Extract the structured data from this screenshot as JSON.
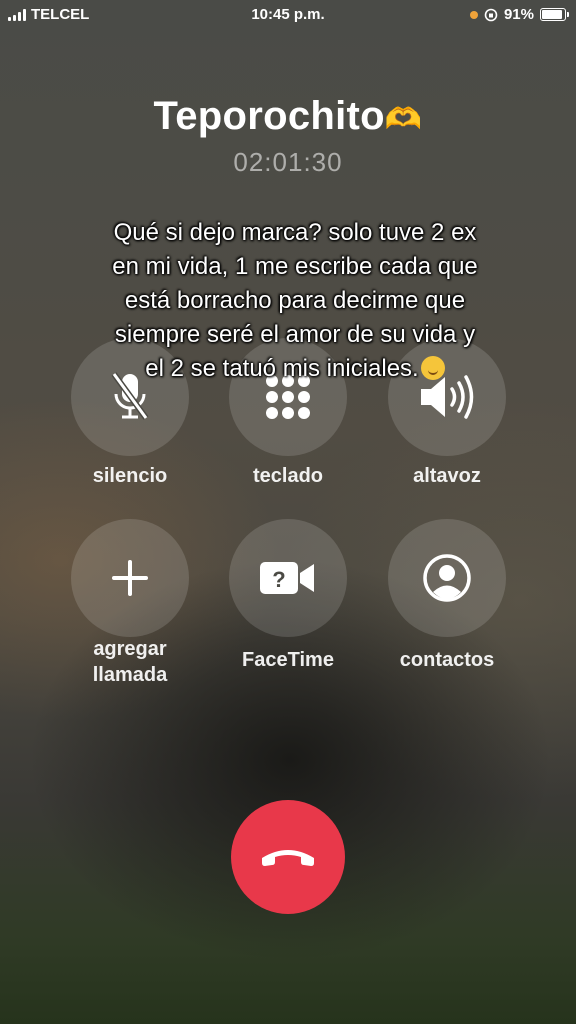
{
  "status_bar": {
    "carrier": "TELCEL",
    "time": "10:45 p.m.",
    "battery_percent": "91%",
    "battery_level": 0.91,
    "icons": [
      "signal-icon",
      "orange-dot-icon",
      "orientation-lock-icon",
      "battery-icon"
    ]
  },
  "call": {
    "contact_name": "Teporochito",
    "name_emoji": "🫶",
    "duration": "02:01:30"
  },
  "overlay": {
    "text": "Qué si dejo marca? solo tuve 2 ex en mi vida, 1 me escribe cada que está borracho para decirme que siempre seré el amor de su vida y el 2 se tatuó mis iniciales."
  },
  "controls": {
    "mute": {
      "label": "silencio",
      "icon": "mic-slash-icon"
    },
    "keypad": {
      "label": "teclado",
      "icon": "keypad-icon"
    },
    "speaker": {
      "label": "altavoz",
      "icon": "speaker-icon"
    },
    "add_call": {
      "label_line1": "agregar",
      "label_line2": "llamada",
      "icon": "plus-icon"
    },
    "facetime": {
      "label": "FaceTime",
      "icon": "facetime-icon"
    },
    "contacts": {
      "label": "contactos",
      "icon": "person-circle-icon"
    }
  },
  "end_call": {
    "icon": "phone-down-icon",
    "color": "#e8384a"
  }
}
